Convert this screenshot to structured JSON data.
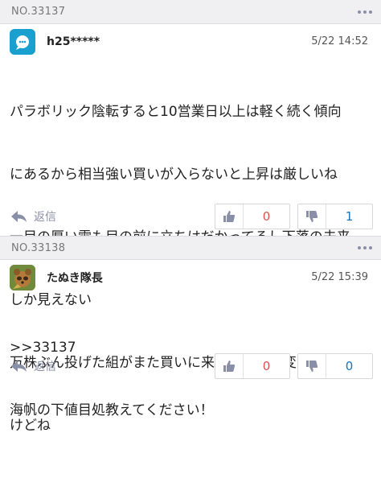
{
  "comments": [
    {
      "number": "NO.33137",
      "username": "h25*****",
      "avatar_icon": "chat-bubble-icon",
      "datetime": "5/22 14:52",
      "lines": [
        "パラボリック陰転すると10営業日以上は軽く続く傾向",
        "にあるから相当強い買いが入らないと上昇は厳しいね",
        "一目の厚い雲も目の前に立ちはだかってるし下落の未来",
        "しか見えない",
        "万株ぶん投げた組がまた買いに来たら状況も変わるんだ",
        "けどね"
      ],
      "reply_label": "返信",
      "good_count": "0",
      "bad_count": "1"
    },
    {
      "number": "NO.33138",
      "username": "たぬき隊長",
      "avatar_icon": "tanuki-avatar-icon",
      "datetime": "5/22 15:39",
      "lines": [
        ">>33137",
        "海帆の下値目処教えてください！"
      ],
      "reply_label": "返信",
      "good_count": "0",
      "bad_count": "0"
    }
  ],
  "colors": {
    "header_bg": "#f0f0f2",
    "good": "#d9534f",
    "bad": "#1a73b8",
    "icon_gray": "#8a8fa8"
  }
}
